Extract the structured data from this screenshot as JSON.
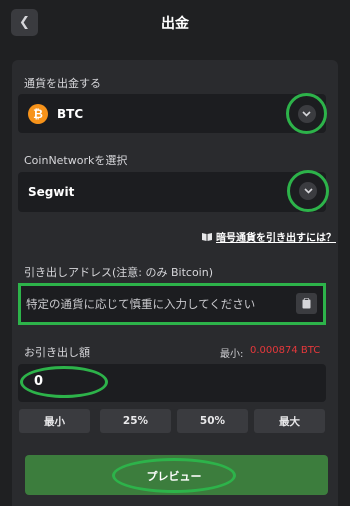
{
  "header": {
    "title": "出金",
    "back_icon": "chevron-left-icon"
  },
  "currency_section": {
    "label": "通貨を出金する",
    "selected_coin": "BTC",
    "coin_icon_glyph": "₿",
    "coin_icon": "bitcoin-icon",
    "coin_color": "#f7931a"
  },
  "network_section": {
    "label": "CoinNetworkを選択",
    "selected_network": "Segwit"
  },
  "help": {
    "label": "暗号通貨を引き出すには？",
    "icon": "book-icon"
  },
  "address_section": {
    "label": "引き出しアドレス(注意: のみ Bitcoin)",
    "placeholder": "特定の通貨に応じて慎重に入力してください",
    "paste_icon": "clipboard-icon"
  },
  "amount_section": {
    "label": "お引き出し額",
    "min_label": "最小:",
    "min_value": "0.000874 BTC",
    "value": "0",
    "quick_buttons": [
      "最小",
      "25%",
      "50%",
      "最大"
    ]
  },
  "preview_button": {
    "label": "プレビュー"
  },
  "colors": {
    "accent_green": "#2db34a",
    "button_green": "#3c7d3d",
    "error_red": "#e5383b",
    "background": "#1f2022",
    "panel": "#2a2b2e"
  }
}
